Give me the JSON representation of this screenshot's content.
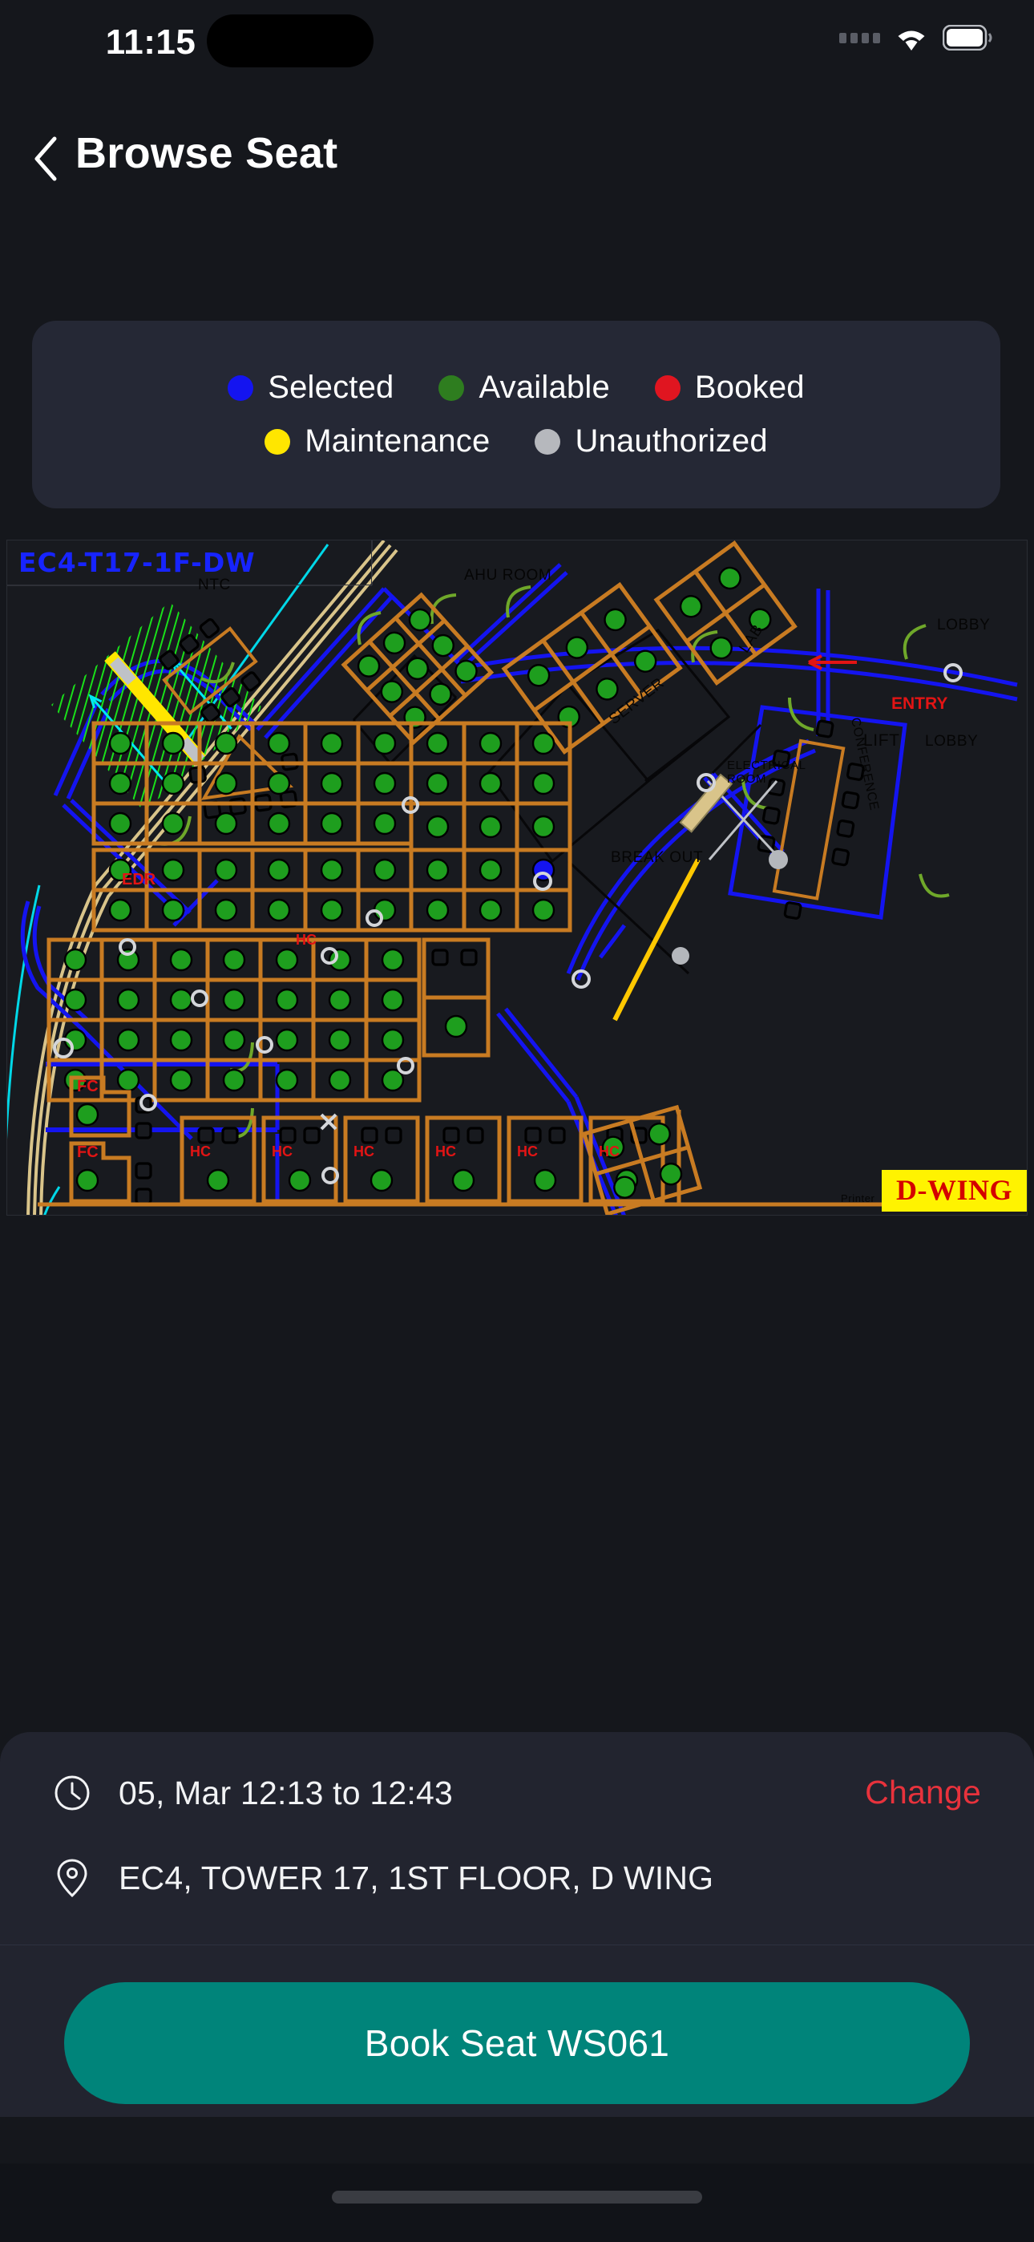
{
  "status_bar": {
    "time": "11:15",
    "signal_icon": "signal-dots-icon",
    "wifi_icon": "wifi-icon",
    "battery_icon": "battery-icon"
  },
  "header": {
    "back_icon": "chevron-left-icon",
    "title": "Browse Seat"
  },
  "legend": {
    "rows": [
      [
        {
          "label": "Selected",
          "color": "#1414F0"
        },
        {
          "label": "Available",
          "color": "#2E7D1F"
        },
        {
          "label": "Booked",
          "color": "#E01520"
        }
      ],
      [
        {
          "label": "Maintenance",
          "color": "#FFE600"
        },
        {
          "label": "Unauthorized",
          "color": "#B6B8BD"
        }
      ]
    ]
  },
  "floor_plan": {
    "code": "EC4-T17-1F-DW",
    "wing_badge": "D-WING",
    "room_labels": [
      "NTC",
      "AHU ROOM",
      "LOBBY",
      "LOBBY",
      "LAB",
      "SERVER",
      "CONFERENCE",
      "LIFT",
      "ELECTRICAL ROOM",
      "BREAK OUT",
      "Printer"
    ],
    "annotations": [
      {
        "text": "EDR",
        "color": "#E21414"
      },
      {
        "text": "ENTRY",
        "color": "#E21414"
      },
      {
        "text": "FC",
        "color": "#E21414"
      },
      {
        "text": "HC",
        "color": "#E21414"
      }
    ],
    "colors": {
      "walls": "#1414F0",
      "desks": "#C87B22",
      "seat_available": "#1E9E1E",
      "seat_selected": "#1414F0",
      "glazing": "#D9C48A",
      "hatch": "#19E019",
      "door_swing": "#6FA82A",
      "accent_line": "#00D8E8"
    },
    "hc_count": 6,
    "fc_count": 2
  },
  "booking_sheet": {
    "time_icon": "clock-icon",
    "time_text": "05, Mar 12:13 to 12:43",
    "change_label": "Change",
    "location_icon": "map-pin-icon",
    "location_text": "EC4, TOWER 17, 1ST FLOOR, D WING"
  },
  "cta": {
    "label": "Book Seat WS061",
    "color": "#00847A"
  },
  "home_indicator": "home-indicator"
}
